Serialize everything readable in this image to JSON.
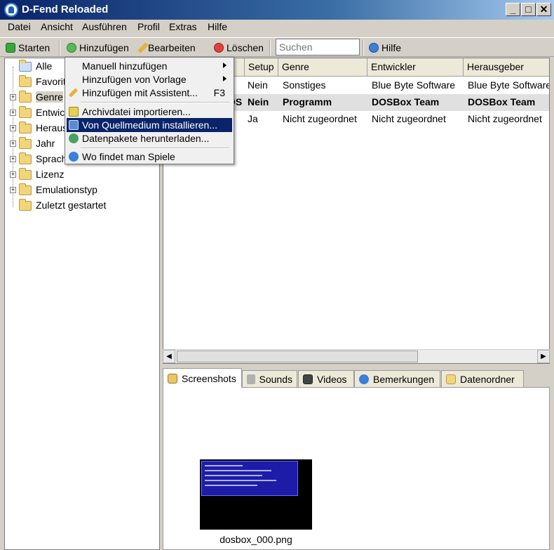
{
  "window": {
    "title": "D-Fend Reloaded",
    "min": "_",
    "max": "□",
    "close": "✕"
  },
  "menubar": [
    "Datei",
    "Ansicht",
    "Ausführen",
    "Profil",
    "Extras",
    "Hilfe"
  ],
  "toolbar": {
    "start": "Starten",
    "add": "Hinzufügen",
    "edit": "Bearbeiten",
    "delete": "Löschen",
    "search_placeholder": "Suchen",
    "help": "Hilfe"
  },
  "tree": [
    "Alle",
    "Favoriten",
    "Genre",
    "Entwickler",
    "Herausgeber",
    "Jahr",
    "Sprache",
    "Lizenz",
    "Emulationstyp",
    "Zuletzt gestartet"
  ],
  "list": {
    "columns": [
      "Setup",
      "Genre",
      "Entwickler",
      "Herausgeber"
    ],
    "rows": [
      {
        "name": "",
        "setup": "Nein",
        "genre": "Sonstiges",
        "dev": "Blue Byte Software",
        "pub": "Blue Byte Software"
      },
      {
        "name": "OS",
        "setup": "Nein",
        "genre": "Programm",
        "dev": "DOSBox Team",
        "pub": "DOSBox Team"
      },
      {
        "name": "",
        "setup": "Ja",
        "genre": "Nicht zugeordnet",
        "dev": "Nicht zugeordnet",
        "pub": "Nicht zugeordnet"
      }
    ]
  },
  "tabs": [
    "Screenshots",
    "Sounds",
    "Videos",
    "Bemerkungen",
    "Datenordner"
  ],
  "screenshot": {
    "caption": "dosbox_000.png"
  },
  "add_menu": {
    "items": [
      {
        "label": "Manuell hinzufügen",
        "submenu": true
      },
      {
        "label": "Hinzufügen von Vorlage",
        "submenu": true
      },
      {
        "label": "Hinzufügen mit Assistent...",
        "shortcut": "F3"
      },
      {
        "label": "Archivdatei importieren..."
      },
      {
        "label": "Von Quellmedium installieren..."
      },
      {
        "label": "Datenpakete herunterladen..."
      },
      {
        "label": "Wo findet man Spiele"
      }
    ]
  },
  "colors": {
    "titlebar": "#0a246a",
    "menu_highlight": "#0a246a",
    "folder": "#f2d47a"
  }
}
